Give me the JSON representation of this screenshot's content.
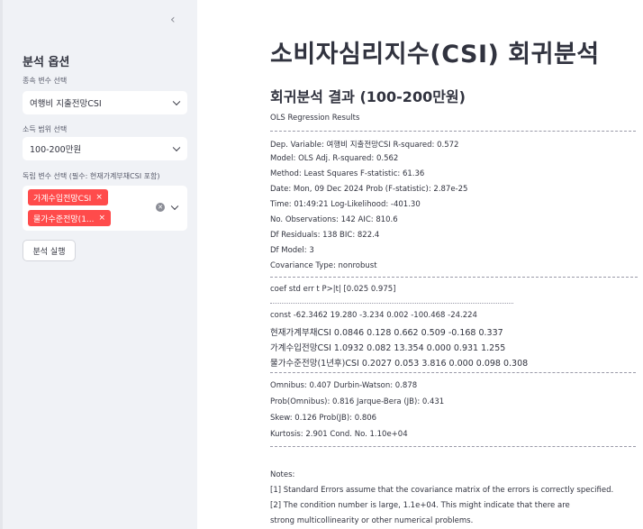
{
  "sidebar": {
    "collapse_icon": "chevron-left-icon",
    "title": "분석 옵션",
    "dep_var_label": "종속 변수 선택",
    "dep_var_value": "여행비 지출전망CSI",
    "income_label": "소득 범위 선택",
    "income_value": "100-200만원",
    "indep_label": "독립 변수 선택 (필수: 현재가계부채CSI 포함)",
    "indep_tags": [
      "가계수입전망CSI",
      "물가수준전망(1..."
    ],
    "tag_remove": "×",
    "run_button": "분석 실행",
    "accent_color": "#ff4b4b"
  },
  "main": {
    "title": "소비자심리지수(CSI) 회귀분석",
    "subtitle": "회귀분석 결과 (100-200만원)",
    "results_header": "OLS Regression Results",
    "summary_lines": [
      "Dep. Variable: 여행비 지출전망CSI R-squared: 0.572",
      "Model: OLS Adj. R-squared: 0.562",
      "Method: Least Squares F-statistic: 61.36",
      "Date: Mon, 09 Dec 2024 Prob (F-statistic): 2.87e-25",
      "Time: 01:49:21 Log-Likelihood: -401.30",
      "No. Observations: 142 AIC: 810.6",
      "Df Residuals: 138 BIC: 822.4",
      "Df Model: 3",
      "Covariance Type: nonrobust"
    ],
    "coef_header": "coef std err t P>|t| [0.025 0.975]",
    "coef_rows": [
      "const -62.3462 19.280 -3.234 0.002 -100.468 -24.224",
      "현재가계부채CSI 0.0846 0.128 0.662 0.509 -0.168 0.337",
      "가계수입전망CSI 1.0932 0.082 13.354 0.000 0.931 1.255",
      "물가수준전망(1년후)CSI 0.2027 0.053 3.816 0.000 0.098 0.308"
    ],
    "diag_lines": [
      "Omnibus: 0.407 Durbin-Watson: 0.878",
      "Prob(Omnibus): 0.816 Jarque-Bera (JB): 0.431",
      "Skew: 0.126 Prob(JB): 0.806",
      "Kurtosis: 2.901 Cond. No. 1.10e+04"
    ],
    "notes_header": "Notes:",
    "notes": [
      "[1] Standard Errors assume that the covariance matrix of the errors is correctly specified.",
      "[2] The condition number is large, 1.1e+04. This might indicate that there are",
      "strong multicollinearity or other numerical problems."
    ]
  }
}
